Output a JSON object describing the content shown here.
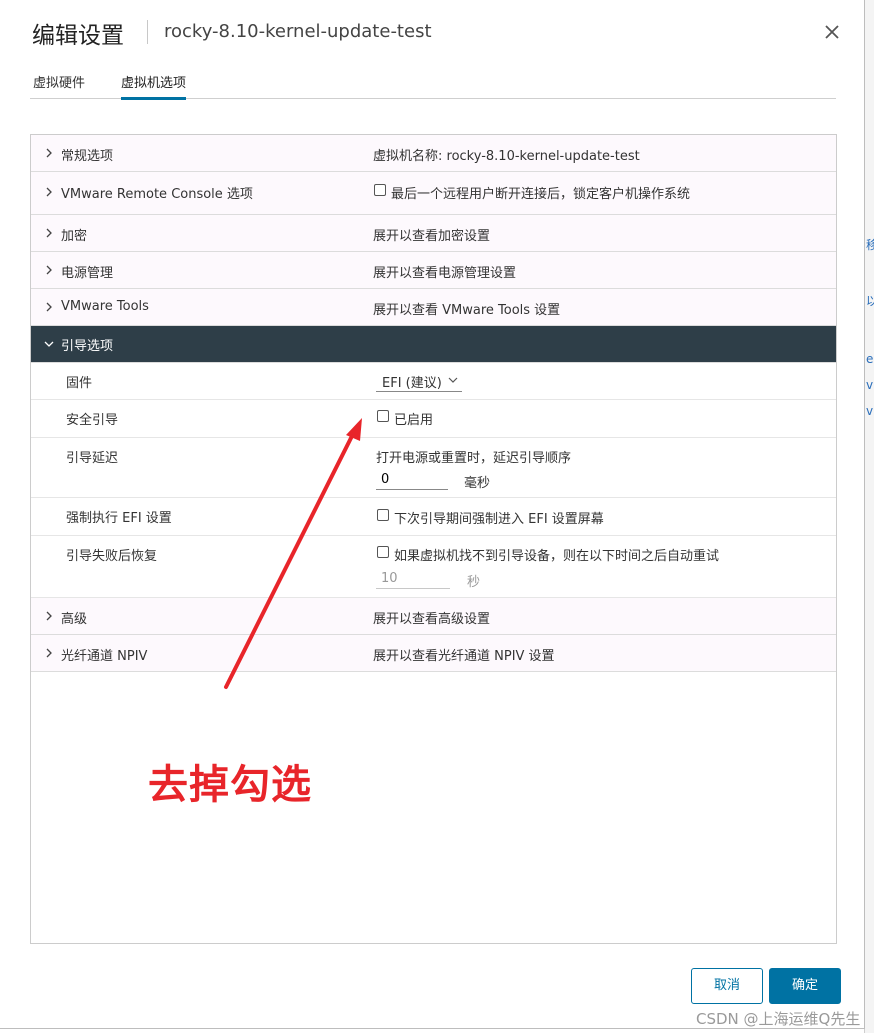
{
  "dialog": {
    "title": "编辑设置",
    "vm_name": "rocky-8.10-kernel-update-test"
  },
  "tabs": [
    {
      "label": "虚拟硬件"
    },
    {
      "label": "虚拟机选项",
      "active": true
    }
  ],
  "rows": {
    "general": {
      "label": "常规选项",
      "value": "虚拟机名称: rocky-8.10-kernel-update-test"
    },
    "vmrc": {
      "label": "VMware Remote Console 选项",
      "value": "最后一个远程用户断开连接后，锁定客户机操作系统",
      "checked": false
    },
    "encryption": {
      "label": "加密",
      "value": "展开以查看加密设置"
    },
    "power": {
      "label": "电源管理",
      "value": "展开以查看电源管理设置"
    },
    "tools": {
      "label": "VMware Tools",
      "value": "展开以查看 VMware Tools 设置"
    },
    "boot": {
      "label": "引导选项",
      "firmware": {
        "label": "固件",
        "value": "EFI (建议)"
      },
      "secure_boot": {
        "label": "安全引导",
        "value": "已启用",
        "checked": false
      },
      "boot_delay": {
        "label": "引导延迟",
        "desc": "打开电源或重置时，延迟引导顺序",
        "value": "0",
        "unit": "毫秒"
      },
      "force_efi": {
        "label": "强制执行 EFI 设置",
        "value": "下次引导期间强制进入 EFI 设置屏幕",
        "checked": false
      },
      "failed_boot": {
        "label": "引导失败后恢复",
        "value": "如果虚拟机找不到引导设备，则在以下时间之后自动重试",
        "checked": false,
        "retry_value": "10",
        "unit": "秒"
      }
    },
    "advanced": {
      "label": "高级",
      "value": "展开以查看高级设置"
    },
    "npiv": {
      "label": "光纤通道 NPIV",
      "value": "展开以查看光纤通道 NPIV 设置"
    }
  },
  "annotation": {
    "text": "去掉勾选",
    "color": "#e8252a"
  },
  "buttons": {
    "cancel": "取消",
    "ok": "确定"
  },
  "watermark": "CSDN @上海运维Q先生",
  "background_fragments": [
    "移",
    "以",
    "e",
    "v",
    "v"
  ],
  "colors": {
    "accent": "#0072a3",
    "active_row": "#2e3e48",
    "row_bg": "#fdf9fd"
  }
}
